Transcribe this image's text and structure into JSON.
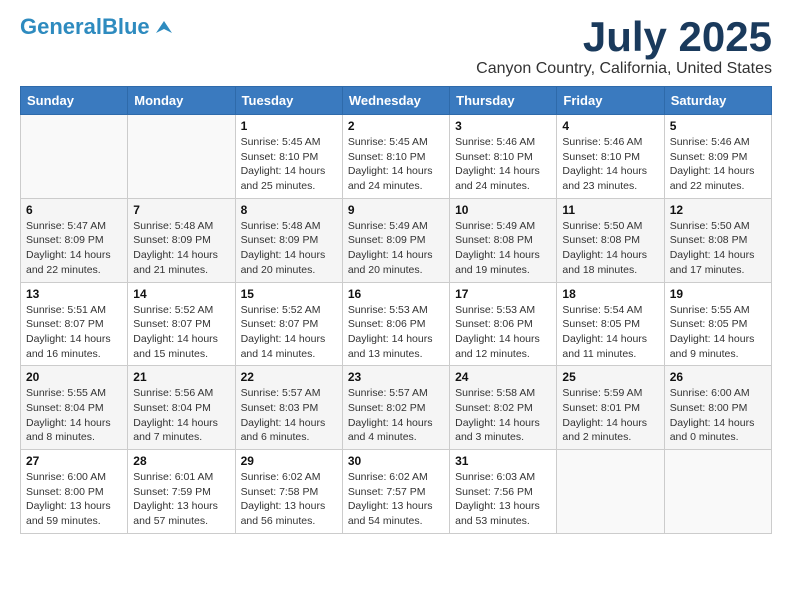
{
  "header": {
    "logo_general": "General",
    "logo_blue": "Blue",
    "main_title": "July 2025",
    "subtitle": "Canyon Country, California, United States"
  },
  "calendar": {
    "days_of_week": [
      "Sunday",
      "Monday",
      "Tuesday",
      "Wednesday",
      "Thursday",
      "Friday",
      "Saturday"
    ],
    "weeks": [
      [
        {
          "day": "",
          "info": ""
        },
        {
          "day": "",
          "info": ""
        },
        {
          "day": "1",
          "info": "Sunrise: 5:45 AM\nSunset: 8:10 PM\nDaylight: 14 hours and 25 minutes."
        },
        {
          "day": "2",
          "info": "Sunrise: 5:45 AM\nSunset: 8:10 PM\nDaylight: 14 hours and 24 minutes."
        },
        {
          "day": "3",
          "info": "Sunrise: 5:46 AM\nSunset: 8:10 PM\nDaylight: 14 hours and 24 minutes."
        },
        {
          "day": "4",
          "info": "Sunrise: 5:46 AM\nSunset: 8:10 PM\nDaylight: 14 hours and 23 minutes."
        },
        {
          "day": "5",
          "info": "Sunrise: 5:46 AM\nSunset: 8:09 PM\nDaylight: 14 hours and 22 minutes."
        }
      ],
      [
        {
          "day": "6",
          "info": "Sunrise: 5:47 AM\nSunset: 8:09 PM\nDaylight: 14 hours and 22 minutes."
        },
        {
          "day": "7",
          "info": "Sunrise: 5:48 AM\nSunset: 8:09 PM\nDaylight: 14 hours and 21 minutes."
        },
        {
          "day": "8",
          "info": "Sunrise: 5:48 AM\nSunset: 8:09 PM\nDaylight: 14 hours and 20 minutes."
        },
        {
          "day": "9",
          "info": "Sunrise: 5:49 AM\nSunset: 8:09 PM\nDaylight: 14 hours and 20 minutes."
        },
        {
          "day": "10",
          "info": "Sunrise: 5:49 AM\nSunset: 8:08 PM\nDaylight: 14 hours and 19 minutes."
        },
        {
          "day": "11",
          "info": "Sunrise: 5:50 AM\nSunset: 8:08 PM\nDaylight: 14 hours and 18 minutes."
        },
        {
          "day": "12",
          "info": "Sunrise: 5:50 AM\nSunset: 8:08 PM\nDaylight: 14 hours and 17 minutes."
        }
      ],
      [
        {
          "day": "13",
          "info": "Sunrise: 5:51 AM\nSunset: 8:07 PM\nDaylight: 14 hours and 16 minutes."
        },
        {
          "day": "14",
          "info": "Sunrise: 5:52 AM\nSunset: 8:07 PM\nDaylight: 14 hours and 15 minutes."
        },
        {
          "day": "15",
          "info": "Sunrise: 5:52 AM\nSunset: 8:07 PM\nDaylight: 14 hours and 14 minutes."
        },
        {
          "day": "16",
          "info": "Sunrise: 5:53 AM\nSunset: 8:06 PM\nDaylight: 14 hours and 13 minutes."
        },
        {
          "day": "17",
          "info": "Sunrise: 5:53 AM\nSunset: 8:06 PM\nDaylight: 14 hours and 12 minutes."
        },
        {
          "day": "18",
          "info": "Sunrise: 5:54 AM\nSunset: 8:05 PM\nDaylight: 14 hours and 11 minutes."
        },
        {
          "day": "19",
          "info": "Sunrise: 5:55 AM\nSunset: 8:05 PM\nDaylight: 14 hours and 9 minutes."
        }
      ],
      [
        {
          "day": "20",
          "info": "Sunrise: 5:55 AM\nSunset: 8:04 PM\nDaylight: 14 hours and 8 minutes."
        },
        {
          "day": "21",
          "info": "Sunrise: 5:56 AM\nSunset: 8:04 PM\nDaylight: 14 hours and 7 minutes."
        },
        {
          "day": "22",
          "info": "Sunrise: 5:57 AM\nSunset: 8:03 PM\nDaylight: 14 hours and 6 minutes."
        },
        {
          "day": "23",
          "info": "Sunrise: 5:57 AM\nSunset: 8:02 PM\nDaylight: 14 hours and 4 minutes."
        },
        {
          "day": "24",
          "info": "Sunrise: 5:58 AM\nSunset: 8:02 PM\nDaylight: 14 hours and 3 minutes."
        },
        {
          "day": "25",
          "info": "Sunrise: 5:59 AM\nSunset: 8:01 PM\nDaylight: 14 hours and 2 minutes."
        },
        {
          "day": "26",
          "info": "Sunrise: 6:00 AM\nSunset: 8:00 PM\nDaylight: 14 hours and 0 minutes."
        }
      ],
      [
        {
          "day": "27",
          "info": "Sunrise: 6:00 AM\nSunset: 8:00 PM\nDaylight: 13 hours and 59 minutes."
        },
        {
          "day": "28",
          "info": "Sunrise: 6:01 AM\nSunset: 7:59 PM\nDaylight: 13 hours and 57 minutes."
        },
        {
          "day": "29",
          "info": "Sunrise: 6:02 AM\nSunset: 7:58 PM\nDaylight: 13 hours and 56 minutes."
        },
        {
          "day": "30",
          "info": "Sunrise: 6:02 AM\nSunset: 7:57 PM\nDaylight: 13 hours and 54 minutes."
        },
        {
          "day": "31",
          "info": "Sunrise: 6:03 AM\nSunset: 7:56 PM\nDaylight: 13 hours and 53 minutes."
        },
        {
          "day": "",
          "info": ""
        },
        {
          "day": "",
          "info": ""
        }
      ]
    ]
  }
}
